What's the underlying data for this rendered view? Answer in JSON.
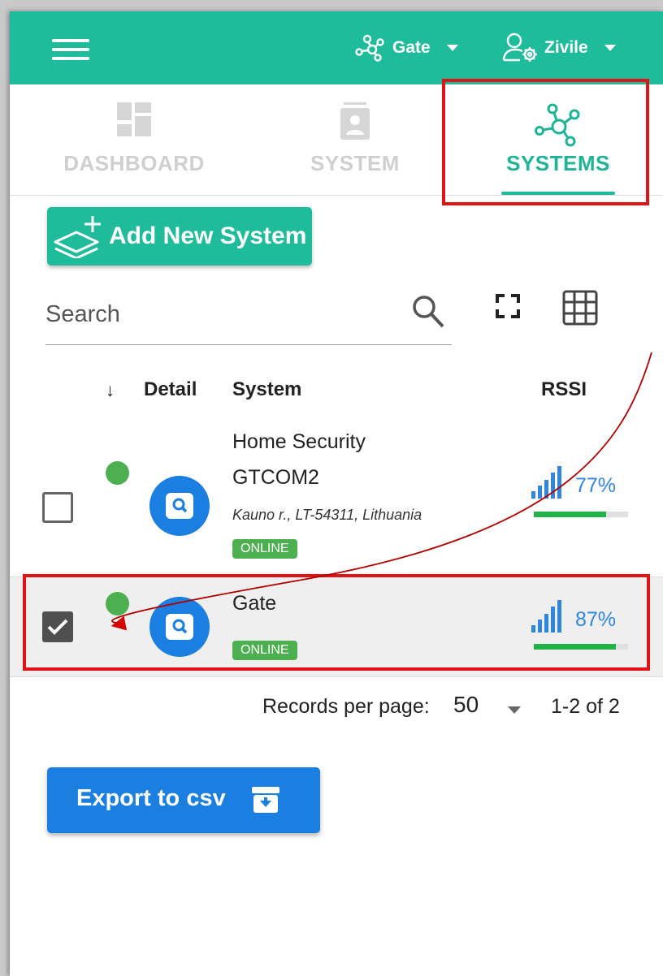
{
  "header": {
    "menu_icon": "hamburger-icon",
    "system_selector": {
      "label": "Gate",
      "icon": "network-icon"
    },
    "user_menu": {
      "label": "Zivile",
      "icon": "user-settings-icon"
    },
    "background_color": "#1fbc9c"
  },
  "tabs": [
    {
      "label": "DASHBOARD",
      "icon": "dashboard-icon",
      "state": "disabled"
    },
    {
      "label": "SYSTEM",
      "icon": "system-card-icon",
      "state": "disabled"
    },
    {
      "label": "SYSTEMS",
      "icon": "network-icon",
      "state": "active"
    }
  ],
  "toolbar": {
    "add_button_label": "Add New System",
    "add_button_icon": "add-layers-icon",
    "search_placeholder": "Search",
    "search_icon": "search-icon",
    "fullscreen_icon": "fullscreen-icon",
    "grid_icon": "grid-view-icon"
  },
  "table": {
    "sort_indicator": "↓",
    "columns": [
      "Detail",
      "System",
      "RSSI"
    ],
    "rows": [
      {
        "checked": false,
        "status": "online",
        "name": "Home Security GTCOM2",
        "name_line1": "Home Security",
        "name_line2": "GTCOM2",
        "address": "Kauno r., LT-54311, Lithuania",
        "badge": "ONLINE",
        "rssi_text": "77%",
        "rssi_value": 0.77
      },
      {
        "checked": true,
        "status": "online",
        "name": "Gate",
        "address": "",
        "badge": "ONLINE",
        "rssi_text": "87%",
        "rssi_value": 0.87
      }
    ]
  },
  "pagination": {
    "label": "Records per page:",
    "per_page": "50",
    "range": "1-2 of 2"
  },
  "export": {
    "label": "Export to csv",
    "icon": "archive-download-icon"
  },
  "colors": {
    "accent": "#1fbc9c",
    "primary_blue": "#1a7fe0",
    "online_green": "#4caf50",
    "highlight_red": "#e01414"
  }
}
